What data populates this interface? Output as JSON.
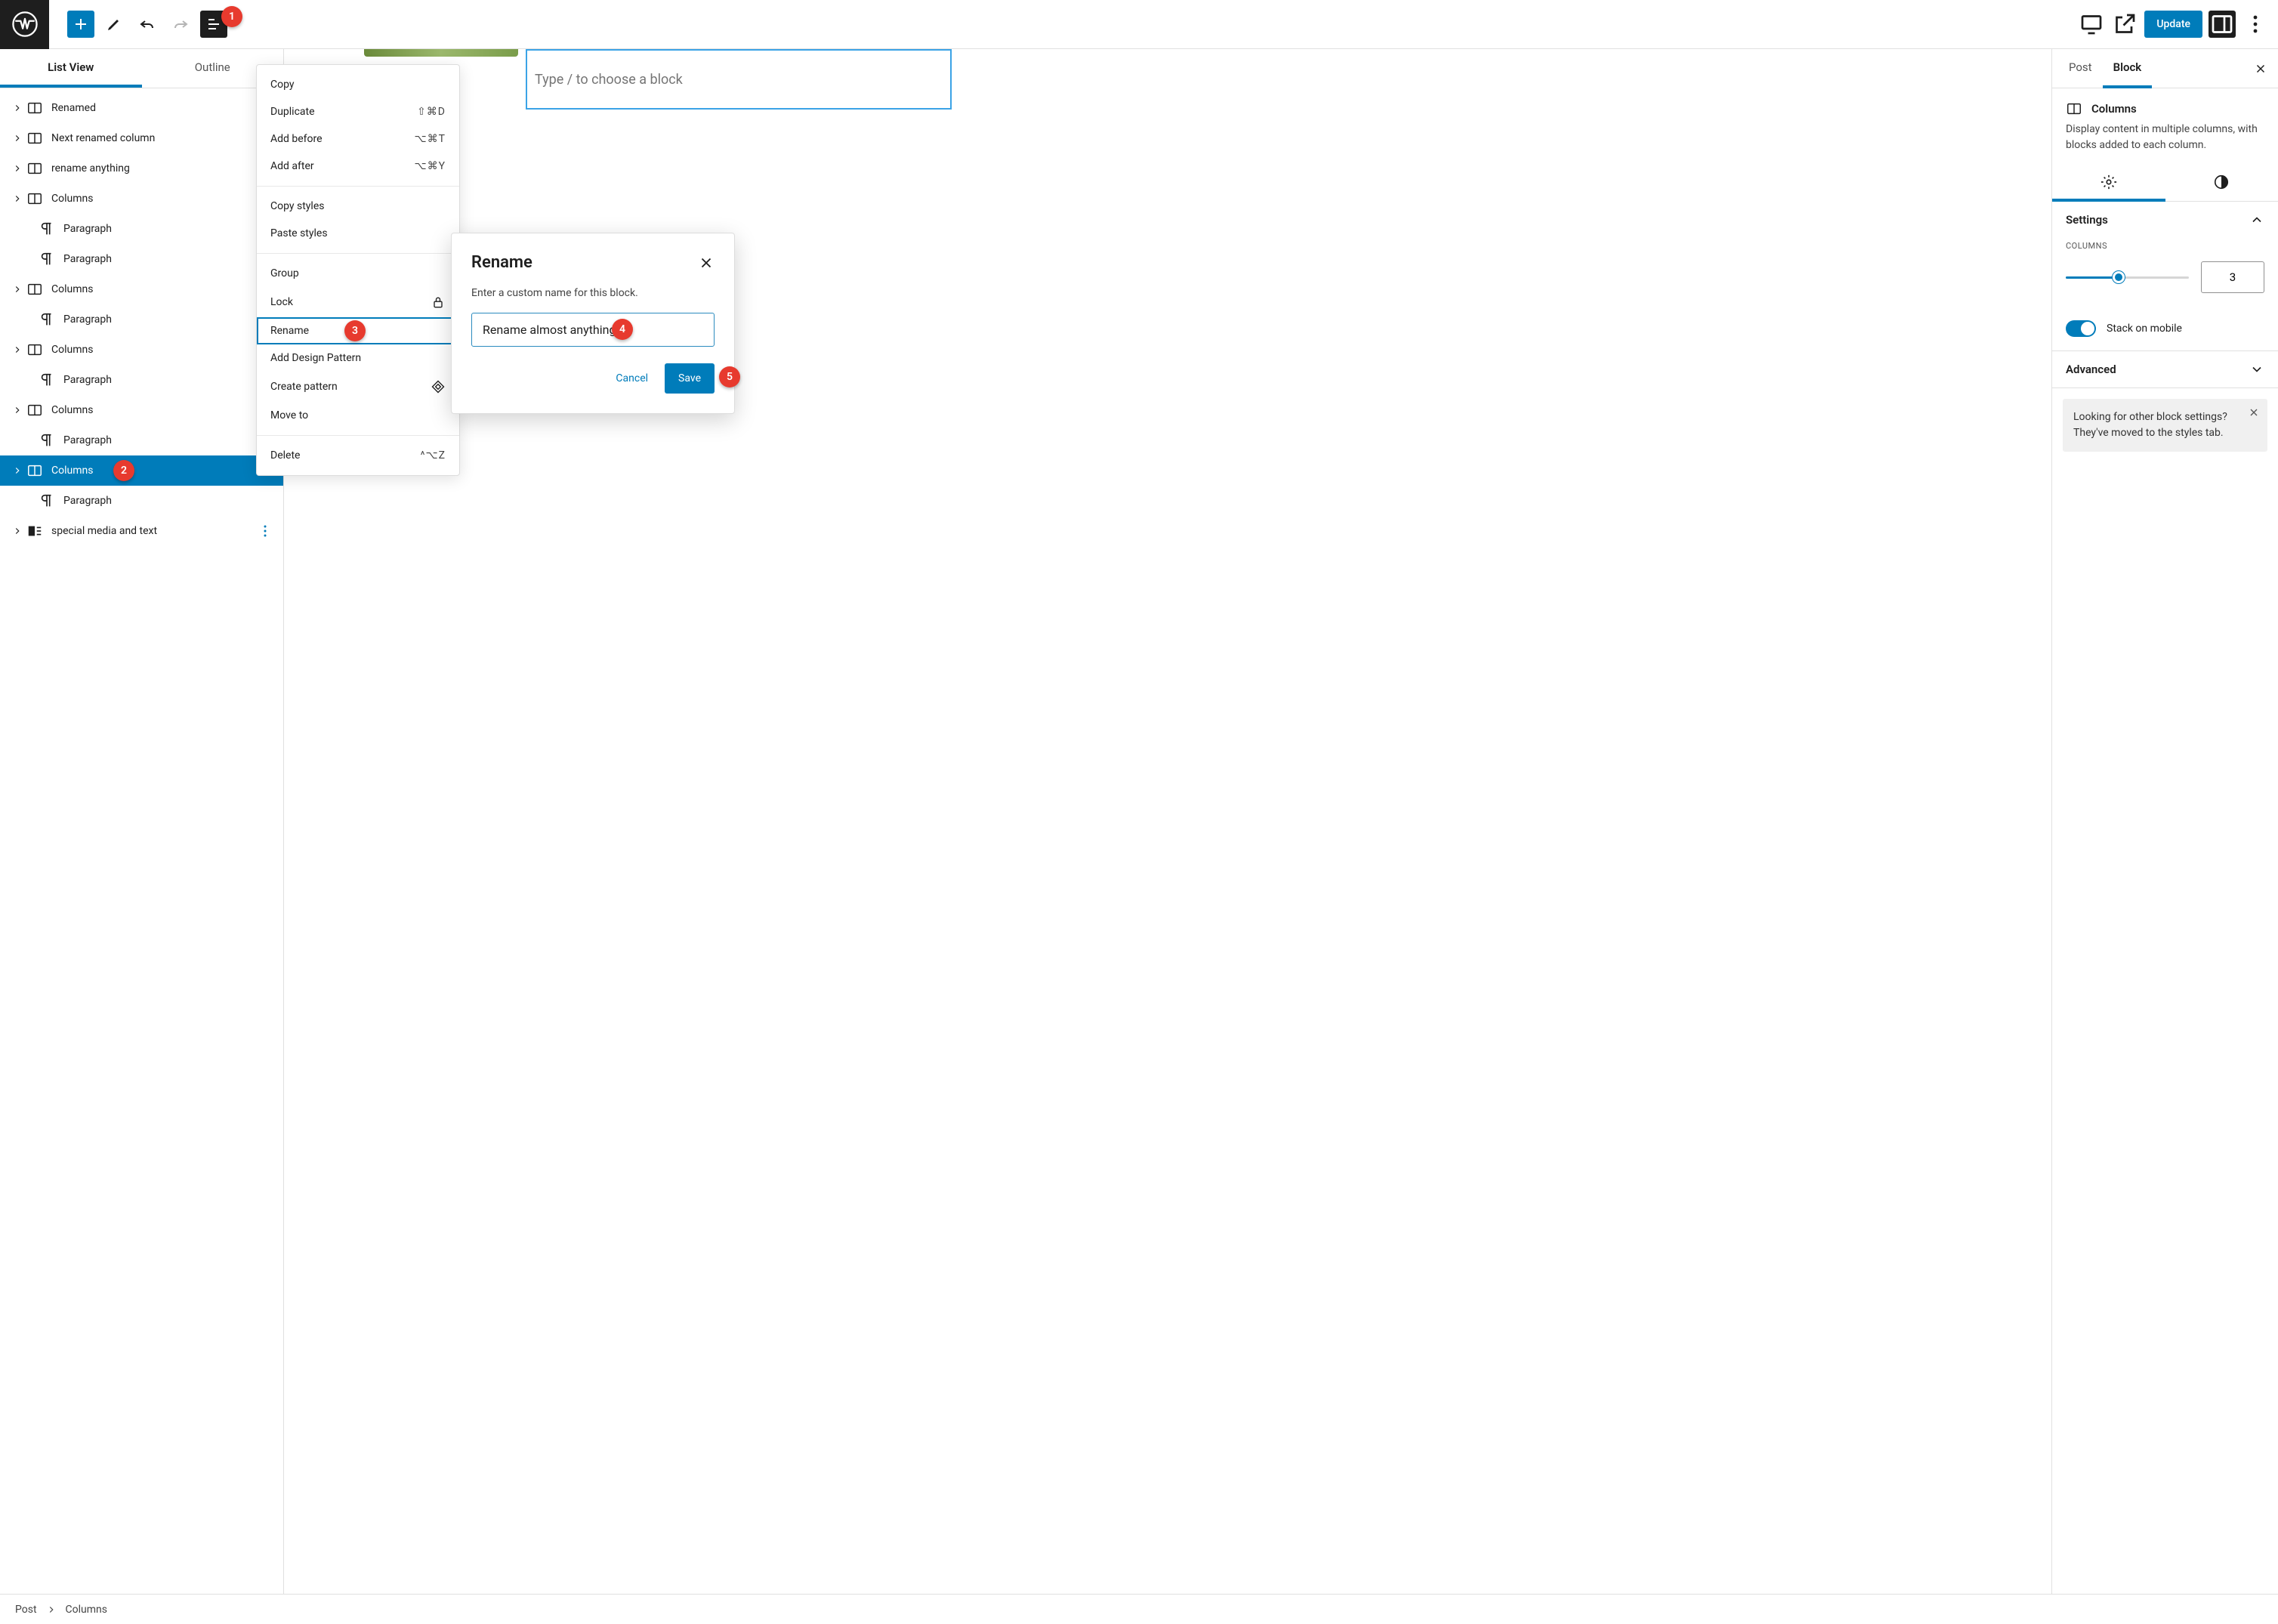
{
  "topbar": {
    "update_label": "Update"
  },
  "badges": {
    "b1": "1",
    "b2": "2",
    "b3": "3",
    "b4": "4",
    "b5": "5"
  },
  "left_tabs": {
    "list_view": "List View",
    "outline": "Outline"
  },
  "tree": [
    {
      "type": "columns",
      "label": "Renamed",
      "expandable": true,
      "indent": 0
    },
    {
      "type": "columns",
      "label": "Next renamed column",
      "expandable": true,
      "indent": 0
    },
    {
      "type": "columns",
      "label": "rename anything",
      "expandable": true,
      "indent": 0
    },
    {
      "type": "columns",
      "label": "Columns",
      "expandable": true,
      "indent": 0
    },
    {
      "type": "paragraph",
      "label": "Paragraph",
      "expandable": false,
      "indent": 1
    },
    {
      "type": "paragraph",
      "label": "Paragraph",
      "expandable": false,
      "indent": 1
    },
    {
      "type": "columns",
      "label": "Columns",
      "expandable": true,
      "indent": 0
    },
    {
      "type": "paragraph",
      "label": "Paragraph",
      "expandable": false,
      "indent": 1
    },
    {
      "type": "columns",
      "label": "Columns",
      "expandable": true,
      "indent": 0
    },
    {
      "type": "paragraph",
      "label": "Paragraph",
      "expandable": false,
      "indent": 1
    },
    {
      "type": "columns",
      "label": "Columns",
      "expandable": true,
      "indent": 0
    },
    {
      "type": "paragraph",
      "label": "Paragraph",
      "expandable": false,
      "indent": 1
    },
    {
      "type": "columns",
      "label": "Columns",
      "expandable": true,
      "indent": 0,
      "selected": true
    },
    {
      "type": "paragraph",
      "label": "Paragraph",
      "expandable": false,
      "indent": 1
    },
    {
      "type": "media",
      "label": "special media and text",
      "expandable": true,
      "indent": 0,
      "more": true
    }
  ],
  "ctx": {
    "copy": "Copy",
    "duplicate": "Duplicate",
    "duplicate_kbd": "⇧⌘D",
    "add_before": "Add before",
    "add_before_kbd": "⌥⌘T",
    "add_after": "Add after",
    "add_after_kbd": "⌥⌘Y",
    "copy_styles": "Copy styles",
    "paste_styles": "Paste styles",
    "group": "Group",
    "lock": "Lock",
    "rename": "Rename",
    "add_design": "Add Design Pattern",
    "create_pattern": "Create pattern",
    "move_to": "Move to",
    "delete": "Delete",
    "delete_kbd": "^⌥Z"
  },
  "canvas": {
    "placeholder": "Type / to choose a block"
  },
  "modal": {
    "title": "Rename",
    "desc": "Enter a custom name for this block.",
    "value": "Rename almost anything",
    "cancel": "Cancel",
    "save": "Save"
  },
  "right": {
    "post_tab": "Post",
    "block_tab": "Block",
    "block_name": "Columns",
    "block_desc": "Display content in multiple columns, with blocks added to each column.",
    "settings_label": "Settings",
    "columns_label": "COLUMNS",
    "columns_value": "3",
    "stack_label": "Stack on mobile",
    "advanced_label": "Advanced",
    "info_text": "Looking for other block settings? They've moved to the styles tab."
  },
  "crumb": {
    "post": "Post",
    "current": "Columns"
  }
}
